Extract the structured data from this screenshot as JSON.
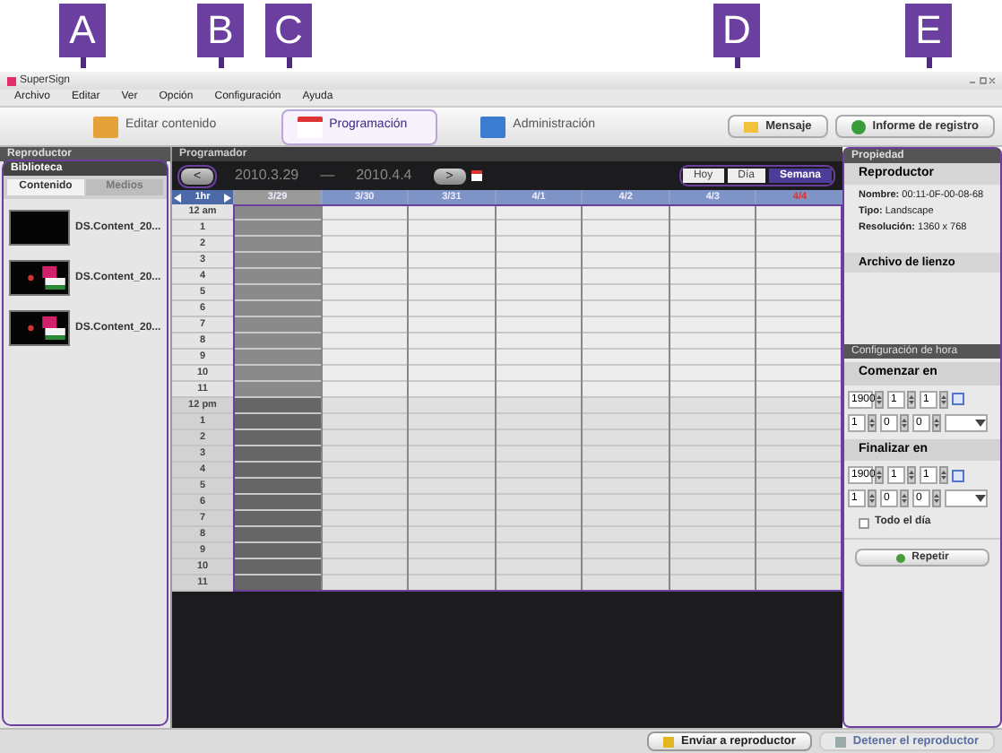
{
  "callouts": [
    "A",
    "B",
    "C",
    "D",
    "E"
  ],
  "app_title": "SuperSign",
  "menu": [
    "Archivo",
    "Editar",
    "Ver",
    "Opción",
    "Configuración",
    "Ayuda"
  ],
  "toolbar_tabs": [
    {
      "label": "Editar contenido",
      "selected": false
    },
    {
      "label": "Programación",
      "selected": true
    },
    {
      "label": "Administración",
      "selected": false
    }
  ],
  "toolbar_buttons": [
    "Mensaje",
    "Informe de registro"
  ],
  "left_panel": {
    "header": "Reproductor",
    "section": "Biblioteca",
    "tabs": [
      {
        "label": "Contenido",
        "selected": true
      },
      {
        "label": "Medios",
        "selected": false
      }
    ],
    "items": [
      {
        "name": "DS.Content_20...",
        "blank": true
      },
      {
        "name": "DS.Content_20...",
        "blank": false
      },
      {
        "name": "DS.Content_20...",
        "blank": false
      }
    ]
  },
  "scheduler": {
    "title": "Programador",
    "prev": "<",
    "next": ">",
    "start": "2010.3.29",
    "separator": "—",
    "end": "2010.4.4",
    "views": [
      {
        "label": "Hoy",
        "selected": false
      },
      {
        "label": "Día",
        "selected": false
      },
      {
        "label": "Semana",
        "selected": true
      }
    ],
    "interval": "1hr",
    "days": [
      {
        "label": "3/29",
        "past": true,
        "weekend": false
      },
      {
        "label": "3/30",
        "past": false,
        "weekend": false
      },
      {
        "label": "3/31",
        "past": false,
        "weekend": false
      },
      {
        "label": "4/1",
        "past": false,
        "weekend": false
      },
      {
        "label": "4/2",
        "past": false,
        "weekend": false
      },
      {
        "label": "4/3",
        "past": false,
        "weekend": false
      },
      {
        "label": "4/4",
        "past": false,
        "weekend": true
      }
    ],
    "hours": [
      "12 am",
      "1",
      "2",
      "3",
      "4",
      "5",
      "6",
      "7",
      "8",
      "9",
      "10",
      "11",
      "12 pm",
      "1",
      "2",
      "3",
      "4",
      "5",
      "6",
      "7",
      "8",
      "9",
      "10",
      "11"
    ]
  },
  "properties": {
    "title": "Propiedad",
    "player": "Reproductor",
    "fields": [
      {
        "label": "Nombre:",
        "value": "00:11-0F-00-08-68"
      },
      {
        "label": "Tipo:",
        "value": "Landscape"
      },
      {
        "label": "Resolución:",
        "value": "1360 x 768"
      }
    ],
    "canvas_title": "Archivo de lienzo",
    "time_title": "Configuración de hora",
    "start": {
      "label": "Comenzar en",
      "date": [
        "1900",
        "1",
        "1"
      ],
      "time": [
        "1",
        "0",
        "0"
      ]
    },
    "end": {
      "label": "Finalizar en",
      "date": [
        "1900",
        "1",
        "1"
      ],
      "time": [
        "1",
        "0",
        "0"
      ]
    },
    "all_day": {
      "label": "Todo el día",
      "checked": false
    },
    "repeat": "Repetir"
  },
  "footer_buttons": [
    "Enviar a reproductor",
    "Detener el reproductor"
  ]
}
